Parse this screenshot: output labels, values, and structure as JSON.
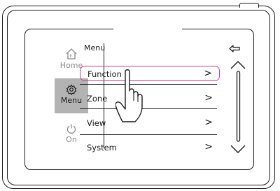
{
  "nav": {
    "home_label": "Home",
    "menu_label": "Menu",
    "on_label": "On",
    "home_icon": "house-icon",
    "menu_icon": "gear-icon",
    "on_icon": "power-icon"
  },
  "menu": {
    "title": "Menu",
    "items": [
      {
        "label": "Function",
        "chevron": ">",
        "selected": true
      },
      {
        "label": "Zone",
        "chevron": ">"
      },
      {
        "label": "View",
        "chevron": ">"
      },
      {
        "label": "System",
        "chevron": ">"
      }
    ]
  },
  "colors": {
    "selection": "#d23c8c",
    "menu_tile": "#b3b3b3"
  }
}
